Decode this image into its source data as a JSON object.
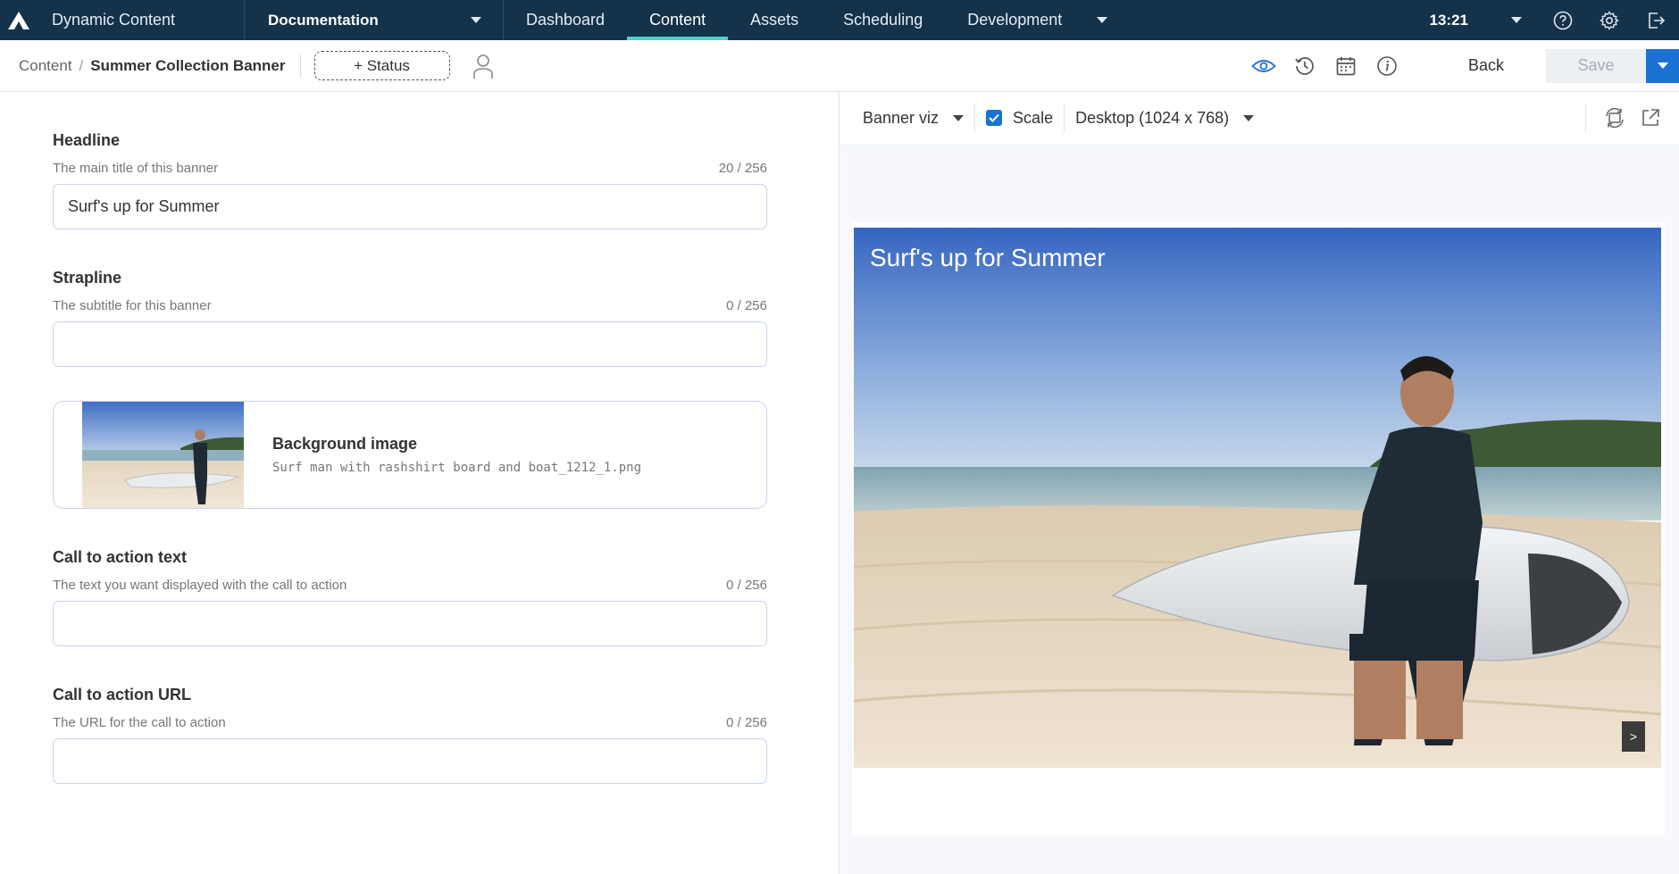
{
  "app": {
    "title": "Dynamic Content",
    "hub": "Documentation",
    "tabs": [
      "Dashboard",
      "Content",
      "Assets",
      "Scheduling",
      "Development"
    ],
    "active_tab": "Content",
    "clock": "13:21"
  },
  "breadcrumb": {
    "root": "Content",
    "separator": "/",
    "current": "Summer Collection Banner"
  },
  "actions": {
    "status_label": "+ Status",
    "back_label": "Back",
    "save_label": "Save"
  },
  "form": {
    "headline": {
      "label": "Headline",
      "description": "The main title of this banner",
      "count": "20 / 256",
      "value": "Surf's up for Summer"
    },
    "strapline": {
      "label": "Strapline",
      "description": "The subtitle for this banner",
      "count": "0 / 256",
      "value": ""
    },
    "background_image": {
      "label": "Background image",
      "filename": "Surf man with rashshirt board and boat_1212_1.png"
    },
    "cta_text": {
      "label": "Call to action text",
      "description": "The text you want displayed with the call to action",
      "count": "0 / 256",
      "value": ""
    },
    "cta_url": {
      "label": "Call to action URL",
      "description": "The URL for the call to action",
      "count": "0 / 256",
      "value": ""
    }
  },
  "preview": {
    "visualization": "Banner viz",
    "scale_label": "Scale",
    "scale_checked": true,
    "device": "Desktop (1024 x 768)",
    "banner_headline": "Surf's up for Summer",
    "next_label": ">"
  },
  "colors": {
    "nav_bg": "#14324a",
    "accent": "#4fd1c5",
    "primary": "#1c72d2"
  }
}
